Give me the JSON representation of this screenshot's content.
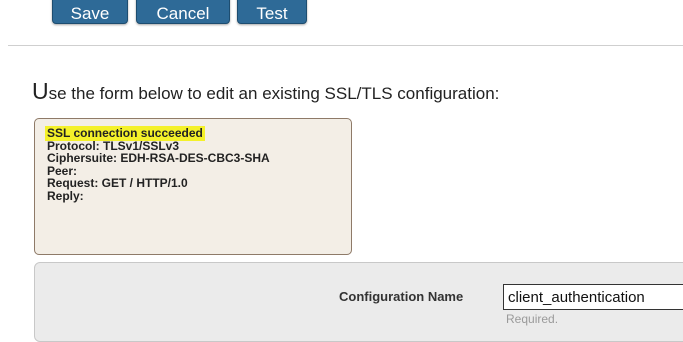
{
  "toolbar": {
    "save_label": "Save",
    "cancel_label": "Cancel",
    "test_label": "Test"
  },
  "intro": {
    "first_letter": "U",
    "rest": "se the form below to edit an existing SSL/TLS configuration:"
  },
  "status": {
    "headline": "SSL connection succeeded",
    "lines": [
      "Protocol: TLSv1/SSLv3",
      "Ciphersuite: EDH-RSA-DES-CBC3-SHA",
      "Peer:",
      "Request: GET / HTTP/1.0",
      "Reply:"
    ],
    "highlight_color": "#f4f12a"
  },
  "form": {
    "configuration_name": {
      "label": "Configuration Name",
      "value": "client_authentication",
      "hint": "Required."
    }
  },
  "colors": {
    "button_bg": "#2e6a97",
    "status_box_bg": "#f3eee6",
    "form_panel_bg": "#ebebeb"
  }
}
